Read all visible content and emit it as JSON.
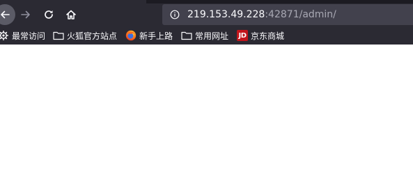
{
  "urlbar": {
    "host": "219.153.49.228",
    "rest": ":42871/admin/"
  },
  "bookmarks": {
    "most_visited": "最常访问",
    "huohu": "火狐官方站点",
    "newbie": "新手上路",
    "common": "常用网址",
    "jd": "京东商城",
    "jd_logo": "JD"
  },
  "icons": {
    "back": "back-arrow-icon",
    "forward": "forward-arrow-icon",
    "reload": "reload-icon",
    "home": "home-icon",
    "info": "info-icon",
    "gear": "gear-icon",
    "folder": "folder-icon",
    "firefox": "firefox-icon"
  },
  "colors": {
    "toolbar": "#2b2a33",
    "urlbar": "#42414d",
    "text": "#fbfbfe",
    "jd_red": "#c2151b"
  }
}
